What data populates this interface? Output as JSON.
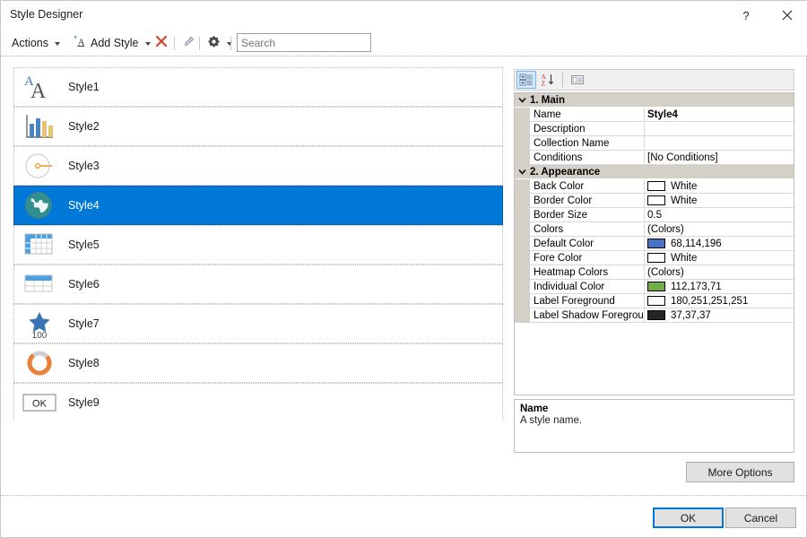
{
  "window": {
    "title": "Style Designer",
    "help_icon": "help-question-icon",
    "help_label": "?",
    "close_icon": "close-icon"
  },
  "toolbar": {
    "actions_label": "Actions",
    "add_style_label": "Add Style",
    "add_style_icon": "add-style-icon",
    "delete_icon": "delete-x-icon",
    "edit_icon": "edit-style-icon",
    "settings_icon": "gear-icon",
    "search": {
      "value": "",
      "placeholder": "Search"
    }
  },
  "style_list": {
    "items": [
      {
        "label": "Style1",
        "icon": "text-style-icon",
        "selected": false
      },
      {
        "label": "Style2",
        "icon": "bar-chart-icon",
        "selected": false
      },
      {
        "label": "Style3",
        "icon": "gauge-icon",
        "selected": false
      },
      {
        "label": "Style4",
        "icon": "globe-icon",
        "selected": true
      },
      {
        "label": "Style5",
        "icon": "table-header-row-col-icon",
        "selected": false
      },
      {
        "label": "Style6",
        "icon": "table-header-row-icon",
        "selected": false
      },
      {
        "label": "Style7",
        "icon": "star-kpi-icon",
        "icon_text": "100",
        "selected": false
      },
      {
        "label": "Style8",
        "icon": "donut-progress-icon",
        "selected": false
      },
      {
        "label": "Style9",
        "icon": "ok-button-icon",
        "icon_text": "OK",
        "selected": false
      }
    ]
  },
  "property_grid": {
    "toolbar": {
      "categorized_icon": "categorized-view-icon",
      "alphabetical_icon": "alphabetical-sort-icon",
      "property_pages_icon": "property-pages-icon"
    },
    "categories": [
      {
        "label": "1. Main",
        "expanded": true,
        "rows": [
          {
            "name": "Name",
            "value": "Style4",
            "bold": true
          },
          {
            "name": "Description",
            "value": ""
          },
          {
            "name": "Collection Name",
            "value": ""
          },
          {
            "name": "Conditions",
            "value": "[No Conditions]"
          }
        ]
      },
      {
        "label": "2. Appearance",
        "expanded": true,
        "rows": [
          {
            "name": "Back Color",
            "value": "White",
            "swatch": "#ffffff"
          },
          {
            "name": "Border Color",
            "value": "White",
            "swatch": "#ffffff"
          },
          {
            "name": "Border Size",
            "value": "0.5"
          },
          {
            "name": "Colors",
            "value": "(Colors)"
          },
          {
            "name": "Default Color",
            "value": "68,114,196",
            "swatch": "#4472c4"
          },
          {
            "name": "Fore Color",
            "value": "White",
            "swatch": "#ffffff"
          },
          {
            "name": "Heatmap Colors",
            "value": "(Colors)"
          },
          {
            "name": "Individual Color",
            "value": "112,173,71",
            "swatch": "#70ad47"
          },
          {
            "name": "Label Foreground",
            "value": "180,251,251,251",
            "swatch": "#fbfbfb"
          },
          {
            "name": "Label Shadow Foregroun",
            "value": "37,37,37",
            "swatch": "#252525"
          }
        ]
      }
    ]
  },
  "description": {
    "title": "Name",
    "body": "A style name."
  },
  "buttons": {
    "more_options": "More Options",
    "ok": "OK",
    "cancel": "Cancel"
  },
  "colors": {
    "selection_blue": "#0078d7",
    "category_gray": "#d4d0c8",
    "accent_orange": "#e8703a"
  }
}
